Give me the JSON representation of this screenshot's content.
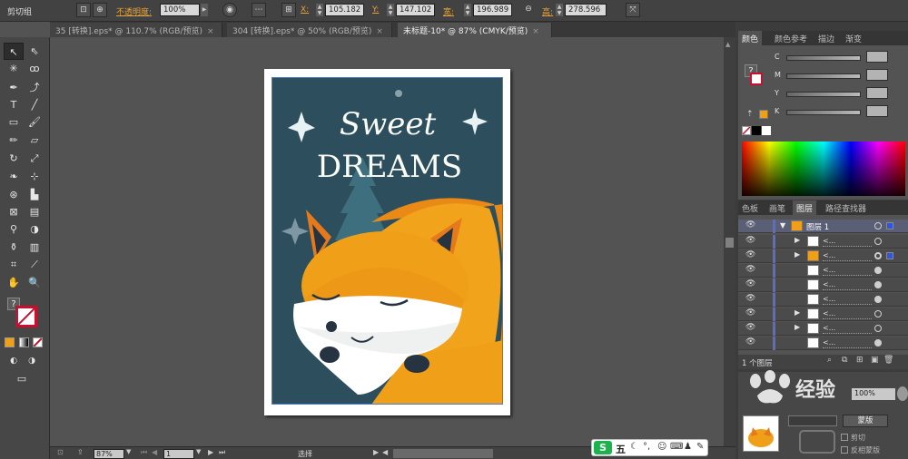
{
  "topbar": {
    "group_label": "剪切组",
    "opacity_label": "不透明度:",
    "opacity_value": "100%",
    "x_label": "X:",
    "x_value": "105.182",
    "y_label": "Y:",
    "y_value": "147.102",
    "width_label": "宽:",
    "width_value": "196.989",
    "height_label": "高:",
    "height_value": "278.596"
  },
  "tabs": [
    {
      "label": "35 [转换].eps* @ 110.7% (RGB/预览)",
      "close": "×"
    },
    {
      "label": "304 [转换].eps* @ 50% (RGB/预览)",
      "close": "×"
    },
    {
      "label": "未标题-10* @ 87% (CMYK/预览)",
      "close": "×"
    }
  ],
  "toolbox": {
    "question_mark": "?"
  },
  "artwork": {
    "title_line1": "Sweet",
    "title_line2": "DREAMS",
    "colors": {
      "background": "#2d4e5d",
      "fox_orange": "#f0a018",
      "fox_dark_orange": "#e57a1c",
      "white": "#ffffff",
      "dark": "#263340"
    }
  },
  "statusbar": {
    "zoom": "87%",
    "page": "1",
    "tool_label": "选择"
  },
  "color_panel": {
    "tabs": [
      "颜色",
      "颜色参考",
      "描边",
      "渐变"
    ],
    "active_tab": "颜色",
    "channels": [
      {
        "label": "C"
      },
      {
        "label": "M"
      },
      {
        "label": "Y"
      },
      {
        "label": "K"
      }
    ],
    "question_mark": "?"
  },
  "layers_panel": {
    "tabs": [
      "色板",
      "画笔",
      "图层",
      "路径查找器"
    ],
    "active_tab": "图层",
    "top_layer": "图层 1",
    "row_names": [
      "<...",
      "<...",
      "<...",
      "<...",
      "<...",
      "<...",
      "<...",
      "<..."
    ],
    "footer_count": "1 个图层"
  },
  "bottom_right": {
    "opacity_value": "100%",
    "mask_button": "蒙版",
    "clip_label": "剪切",
    "invert_mask_label": "反相蒙版",
    "link_label": "链接"
  },
  "watermark": {
    "text": "经验"
  },
  "ime": {
    "label": "五"
  }
}
